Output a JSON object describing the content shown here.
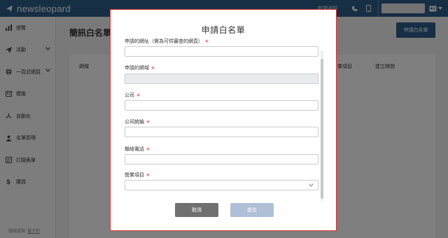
{
  "app": {
    "brand": "newsleopard",
    "top_link": "新聞通知",
    "accent_color": "#2e5f8a",
    "overlay_color": "rgba(0,0,0,0.5)"
  },
  "sidebar": {
    "items": [
      {
        "label": "總覽",
        "icon": "bar-chart-icon"
      },
      {
        "label": "活動",
        "icon": "paper-plane-icon",
        "expandable": true
      },
      {
        "label": "一頁式網頁",
        "icon": "globe-icon",
        "expandable": true
      },
      {
        "label": "模版",
        "icon": "template-icon"
      },
      {
        "label": "自動化",
        "icon": "flow-icon"
      },
      {
        "label": "名單管理",
        "icon": "user-icon"
      },
      {
        "label": "訂閱表單",
        "icon": "form-icon"
      },
      {
        "label": "購買",
        "icon": "dollar-icon"
      }
    ],
    "footer_prefix": "服務提供",
    "footer_link": "電子豹"
  },
  "main": {
    "page_title": "簡訊白名單",
    "primary_button": "申請白名單",
    "table_headers": {
      "col1": "網域",
      "col2": "業項目",
      "col3": "建立時間"
    }
  },
  "modal": {
    "title": "申請白名單",
    "fields": [
      {
        "label": "申請的網址（需為可供審查的網頁）",
        "required": true,
        "value": "",
        "disabled": false
      },
      {
        "label": "申請的網域",
        "required": true,
        "value": "",
        "disabled": true
      },
      {
        "label": "公司",
        "required": true,
        "value": "",
        "disabled": false
      },
      {
        "label": "公司統編",
        "required": true,
        "value": "",
        "disabled": false
      },
      {
        "label": "聯絡電話",
        "required": true,
        "value": "",
        "disabled": false
      },
      {
        "label": "營業項目",
        "required": true,
        "value": "",
        "type": "select"
      }
    ],
    "required_mark": "＊",
    "cancel_label": "取消",
    "submit_label": "提交"
  }
}
